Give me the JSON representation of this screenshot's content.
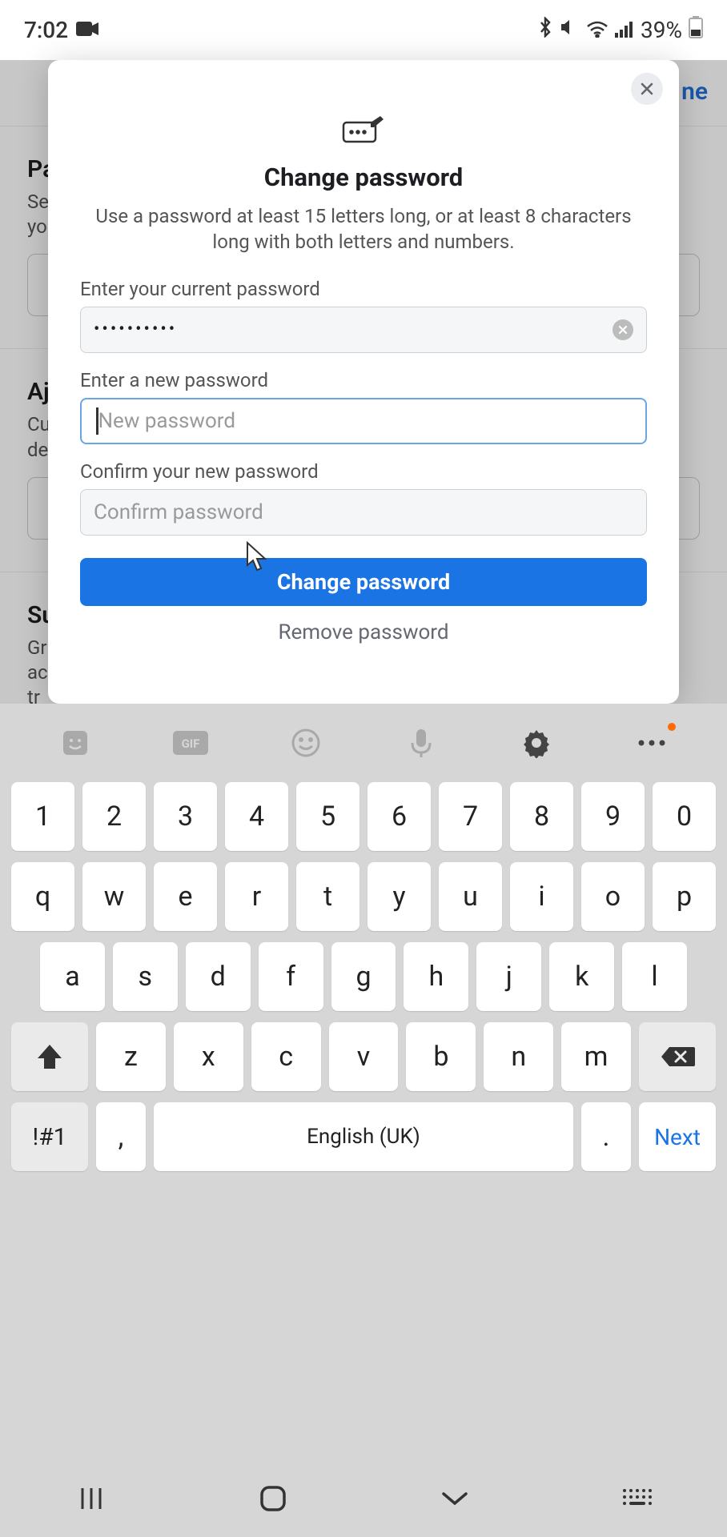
{
  "statusbar": {
    "time": "7:02",
    "battery": "39%"
  },
  "background": {
    "done": "ne",
    "sections": [
      {
        "title_prefix": "Pa",
        "sub_prefix": "Se\nyo"
      },
      {
        "title_prefix": "Aj",
        "sub_prefix": "Cu\nde"
      },
      {
        "title_prefix": "Su",
        "sub_prefix": "Gr\nac\ntr"
      }
    ]
  },
  "modal": {
    "title": "Change password",
    "description": "Use a password at least 15 letters long, or at least 8 characters long with both letters and numbers.",
    "labels": {
      "current": "Enter your current password",
      "new": "Enter a new password",
      "confirm": "Confirm your new password"
    },
    "inputs": {
      "current_masked": "••••••••••",
      "new_placeholder": "New password",
      "confirm_placeholder": "Confirm password"
    },
    "buttons": {
      "primary": "Change password",
      "remove": "Remove password"
    }
  },
  "keyboard": {
    "row1": [
      "1",
      "2",
      "3",
      "4",
      "5",
      "6",
      "7",
      "8",
      "9",
      "0"
    ],
    "row2": [
      "q",
      "w",
      "e",
      "r",
      "t",
      "y",
      "u",
      "i",
      "o",
      "p"
    ],
    "row3": [
      "a",
      "s",
      "d",
      "f",
      "g",
      "h",
      "j",
      "k",
      "l"
    ],
    "row4": [
      "z",
      "x",
      "c",
      "v",
      "b",
      "n",
      "m"
    ],
    "sym": "!#1",
    "comma": ",",
    "space": "English (UK)",
    "dot": ".",
    "next": "Next"
  }
}
